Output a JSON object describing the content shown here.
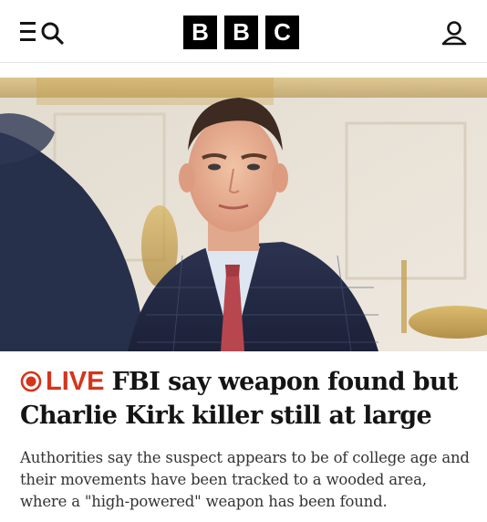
{
  "header": {
    "logo_letters": [
      "B",
      "B",
      "C"
    ],
    "menu_icon": "menu-search-icon",
    "account_icon": "user-account-icon"
  },
  "hero": {
    "image_description_icon": "news-photo"
  },
  "article": {
    "live_label": "LIVE",
    "headline": "FBI say weapon found but Charlie Kirk killer still at large",
    "summary": "Authorities say the suspect appears to be of college age and their movements have been tracked to a wooded area, where a \"high-powered\" weapon has been found."
  },
  "colors": {
    "live_red": "#d4351c",
    "text": "#141414",
    "summary_text": "#333333",
    "logo_bg": "#000000"
  }
}
